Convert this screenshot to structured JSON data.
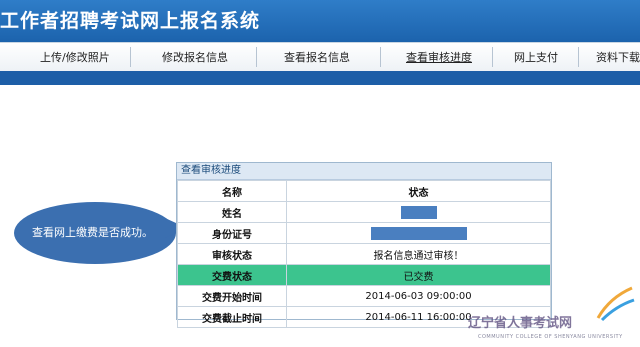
{
  "header": {
    "title": "工作者招聘考试网上报名系统"
  },
  "nav": {
    "items": [
      {
        "label": "上传/修改照片"
      },
      {
        "label": "修改报名信息"
      },
      {
        "label": "查看报名信息"
      },
      {
        "label": "查看审核进度"
      },
      {
        "label": "网上支付"
      },
      {
        "label": "资料下载"
      }
    ]
  },
  "callout": {
    "text": "查看网上缴费是否成功。"
  },
  "panel": {
    "caption": "查看审核进度",
    "head": {
      "col1": "名称",
      "col2": "状态"
    },
    "rows": [
      {
        "label": "姓名",
        "value": ""
      },
      {
        "label": "身份证号",
        "value": ""
      },
      {
        "label": "审核状态",
        "value": "报名信息通过审核！"
      },
      {
        "label": "交费状态",
        "value": "已交费"
      },
      {
        "label": "交费开始时间",
        "value": "2014-06-03 09:00:00"
      },
      {
        "label": "交费截止时间",
        "value": "2014-06-11 16:00:00"
      }
    ]
  },
  "watermark": {
    "text": "辽宁省人事考试网",
    "sub": "COMMUNITY COLLEGE OF SHENYANG UNIVERSITY"
  },
  "colors": {
    "header": "#1c63ad",
    "highlight_row": "#3cc48e",
    "callout": "#3b6fb0"
  }
}
